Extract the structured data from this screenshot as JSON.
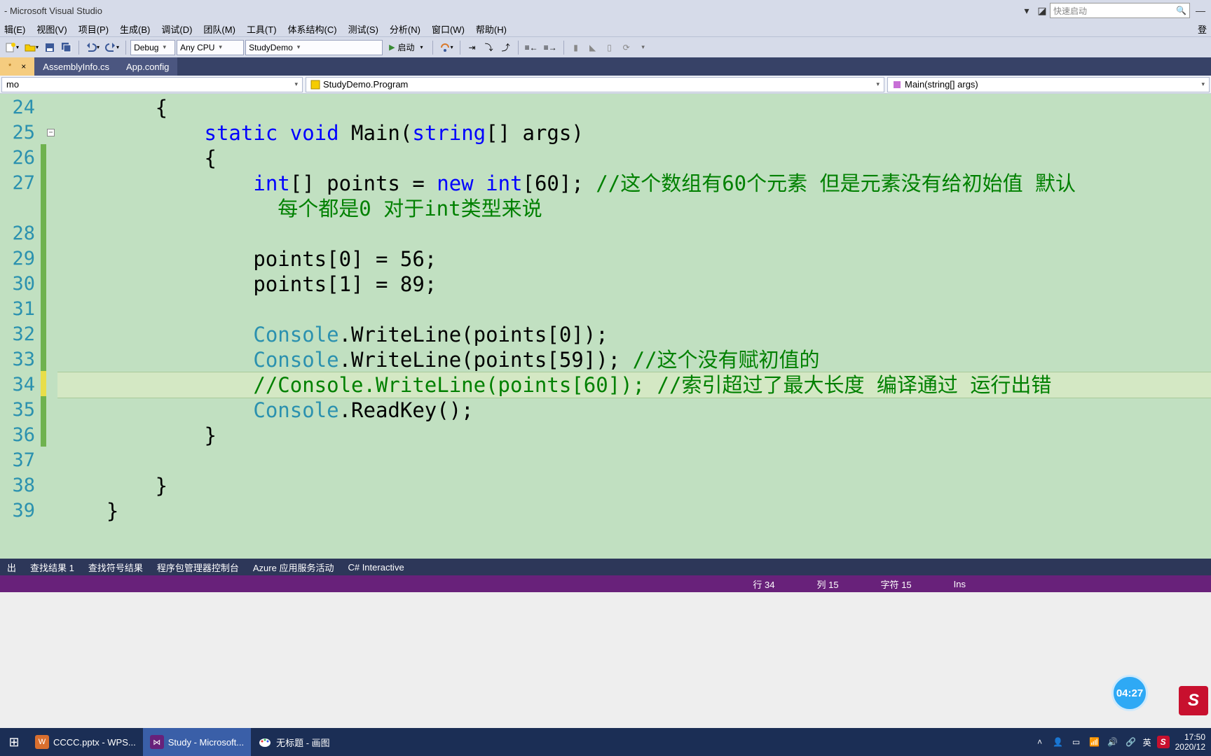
{
  "title_suffix": " - Microsoft Visual Studio",
  "quick_launch_placeholder": "快速启动",
  "menu": [
    "辑(E)",
    "视图(V)",
    "项目(P)",
    "生成(B)",
    "调试(D)",
    "团队(M)",
    "工具(T)",
    "体系结构(C)",
    "测试(S)",
    "分析(N)",
    "窗口(W)",
    "帮助(H)"
  ],
  "menu_right": "登",
  "toolbar": {
    "config": "Debug",
    "platform": "Any CPU",
    "project": "StudyDemo",
    "start": "启动"
  },
  "tabs": [
    {
      "label": "",
      "active": true
    },
    {
      "label": "AssemblyInfo.cs",
      "active": false
    },
    {
      "label": "App.config",
      "active": false
    }
  ],
  "nav": {
    "left": "mo",
    "mid": "StudyDemo.Program",
    "right": "Main(string[] args)"
  },
  "lines_start": 24,
  "code_lines": [
    {
      "n": 24,
      "html": "        {"
    },
    {
      "n": 25,
      "html": "            <span class='kw'>static</span> <span class='kw'>void</span> Main(<span class='kw'>string</span>[] args)"
    },
    {
      "n": 26,
      "html": "            {",
      "mod": "g"
    },
    {
      "n": 27,
      "html": "                <span class='kw'>int</span>[] points = <span class='kw'>new</span> <span class='kw'>int</span>[60]; <span class='cm'>//这个数组有60个元素 但是元素没有给初始值 默认</span>",
      "mod": "g"
    },
    {
      "n": 0,
      "html": "                  <span class='cm'>每个都是0 对于int类型来说</span>",
      "mod": "g",
      "cont": true
    },
    {
      "n": 28,
      "html": "",
      "mod": "g"
    },
    {
      "n": 29,
      "html": "                points[0] = 56;",
      "mod": "g"
    },
    {
      "n": 30,
      "html": "                points[1] = 89;",
      "mod": "g"
    },
    {
      "n": 31,
      "html": "",
      "mod": "g"
    },
    {
      "n": 32,
      "html": "                <span class='tp'>Console</span>.WriteLine(points[0]);",
      "mod": "g"
    },
    {
      "n": 33,
      "html": "                <span class='tp'>Console</span>.WriteLine(points[59]); <span class='cm'>//这个没有赋初值的</span>",
      "mod": "g"
    },
    {
      "n": 34,
      "html": "                <span class='cm'>//Console.WriteLine(points[60]); //索引超过了最大长度 编译通过 运行出错</span>",
      "mod": "y",
      "cursor": true
    },
    {
      "n": 35,
      "html": "                <span class='tp'>Console</span>.ReadKey();",
      "mod": "g"
    },
    {
      "n": 36,
      "html": "            }",
      "mod": "g"
    },
    {
      "n": 37,
      "html": ""
    },
    {
      "n": 38,
      "html": "        }"
    },
    {
      "n": 39,
      "html": "    }"
    }
  ],
  "bottom_tabs": [
    "出",
    "查找结果 1",
    "查找符号结果",
    "程序包管理器控制台",
    "Azure 应用服务活动",
    "C# Interactive"
  ],
  "status": {
    "line": "行 34",
    "col": "列 15",
    "char": "字符 15",
    "ins": "Ins"
  },
  "badge_time": "04:27",
  "task_items": [
    {
      "label": "CCCC.pptx - WPS...",
      "color": "#d96f2e"
    },
    {
      "label": "Study - Microsoft...",
      "color": "#68217a",
      "active": true
    },
    {
      "label": "无标题 - 画图",
      "color": "#2b7cd3"
    }
  ],
  "tray": {
    "ime": "英",
    "time": "17:50",
    "date": "2020/12"
  }
}
